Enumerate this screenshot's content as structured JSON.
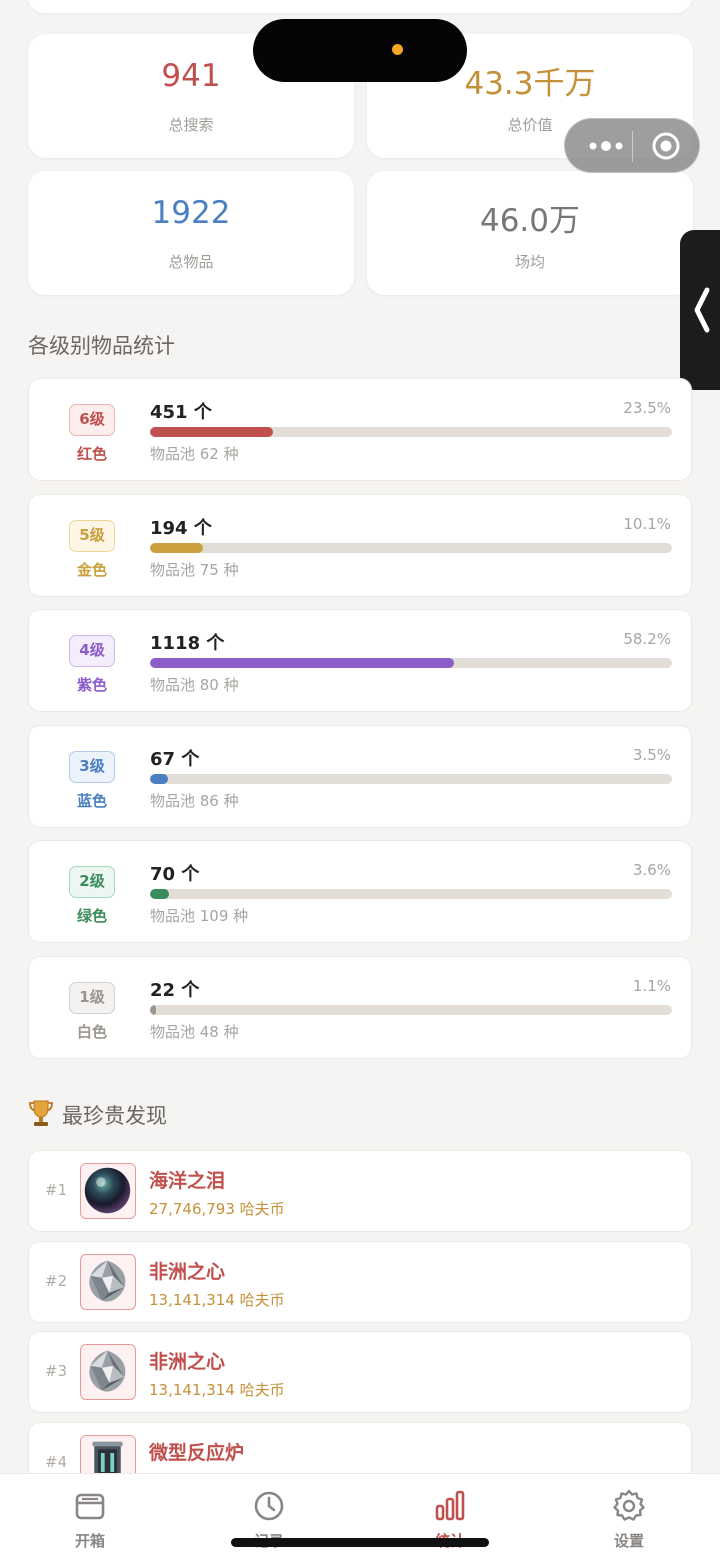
{
  "stats": [
    {
      "value": "941",
      "label": "总搜索",
      "color": "#c0504d"
    },
    {
      "value": "43.3千万",
      "label": "总价值",
      "color": "#c4913a"
    },
    {
      "value": "1922",
      "label": "总物品",
      "color": "#4a7fc1"
    },
    {
      "value": "46.0万",
      "label": "场均",
      "color": "#777777"
    }
  ],
  "rarity_section_title": "各级别物品统计",
  "rarities": [
    {
      "level": "6级",
      "color_name": "红色",
      "count": "451 个",
      "percent": "23.5%",
      "fraction": 0.235,
      "pool": "物品池 62 种",
      "color": "#c0504d",
      "badge_bg": "#fdeeee",
      "badge_border": "#eeb3b3"
    },
    {
      "level": "5级",
      "color_name": "金色",
      "count": "194 个",
      "percent": "10.1%",
      "fraction": 0.101,
      "pool": "物品池 75 种",
      "color": "#c9a03c",
      "badge_bg": "#fdf6e6",
      "badge_border": "#ecd69a"
    },
    {
      "level": "4级",
      "color_name": "紫色",
      "count": "1118 个",
      "percent": "58.2%",
      "fraction": 0.582,
      "pool": "物品池 80 种",
      "color": "#8c5cc9",
      "badge_bg": "#f4eefc",
      "badge_border": "#cdb6ea"
    },
    {
      "level": "3级",
      "color_name": "蓝色",
      "count": "67 个",
      "percent": "3.5%",
      "fraction": 0.035,
      "pool": "物品池 86 种",
      "color": "#4a7fc1",
      "badge_bg": "#edf3fb",
      "badge_border": "#b3cbea"
    },
    {
      "level": "2级",
      "color_name": "绿色",
      "count": "70 个",
      "percent": "3.6%",
      "fraction": 0.036,
      "pool": "物品池 109 种",
      "color": "#3a8c5c",
      "badge_bg": "#edf7f1",
      "badge_border": "#a9d7bb"
    },
    {
      "level": "1级",
      "color_name": "白色",
      "count": "22 个",
      "percent": "1.1%",
      "fraction": 0.011,
      "pool": "物品池 48 种",
      "color": "#9a958f",
      "badge_bg": "#f3f2f1",
      "badge_border": "#d3d0cc"
    }
  ],
  "valuable_section_title": "最珍贵发现",
  "valuables": [
    {
      "rank": "#1",
      "name": "海洋之泪",
      "value": "27,746,793 哈夫币",
      "icon": "black-pearl-icon"
    },
    {
      "rank": "#2",
      "name": "非洲之心",
      "value": "13,141,314 哈夫币",
      "icon": "diamond-icon"
    },
    {
      "rank": "#3",
      "name": "非洲之心",
      "value": "13,141,314 哈夫币",
      "icon": "diamond-icon"
    },
    {
      "rank": "#4",
      "name": "微型反应炉",
      "value": "",
      "icon": "reactor-icon"
    }
  ],
  "tabs": [
    {
      "label": "开箱",
      "icon": "box-icon",
      "active": false
    },
    {
      "label": "记录",
      "icon": "clock-icon",
      "active": false
    },
    {
      "label": "统计",
      "icon": "bar-chart-icon",
      "active": true
    },
    {
      "label": "设置",
      "icon": "gear-icon",
      "active": false
    }
  ],
  "colors": {
    "accent": "#c0504d",
    "background": "#f5f4f2"
  }
}
